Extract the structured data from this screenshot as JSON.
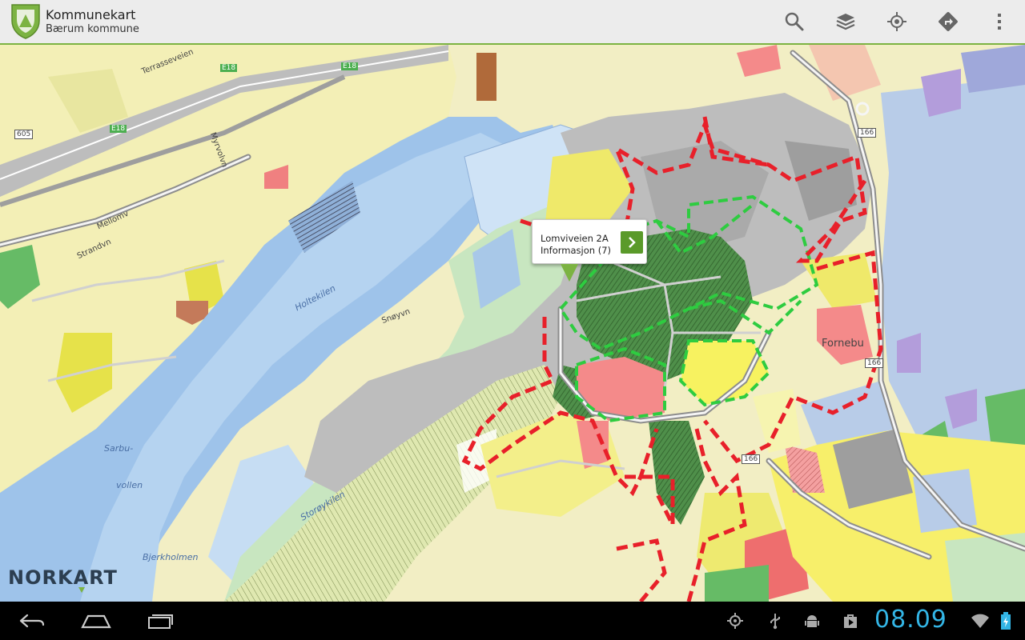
{
  "app": {
    "title": "Kommunekart",
    "subtitle": "Bærum kommune",
    "accent": "#7cb342"
  },
  "actionbar": {
    "actions": [
      {
        "icon": "search-icon",
        "label": "Search"
      },
      {
        "icon": "layers-icon",
        "label": "Layers"
      },
      {
        "icon": "my-location-icon",
        "label": "My location"
      },
      {
        "icon": "directions-icon",
        "label": "Directions"
      },
      {
        "icon": "overflow-menu-icon",
        "label": "More"
      }
    ]
  },
  "map": {
    "labels": {
      "holtekilen": "Holtekilen",
      "storoykilen": "Storøykilen",
      "sarbu": "Sarbu-",
      "vollen": "vollen",
      "bjerkholmen": "Bjerkholmen",
      "fornebu": "Fornebu",
      "terrasseveien": "Terrasseveien",
      "myrvolvn": "Myrvolvn",
      "mellomv": "Mellomv",
      "strandvn": "Strandvn",
      "snoyvn": "Snøyvn",
      "r166a": "166",
      "r166b": "166",
      "r166c": "166",
      "e18a": "E18",
      "e18b": "E18",
      "e18c": "E18",
      "r605": "605"
    },
    "callout": {
      "line1": "Lomviveien 2A",
      "line2": "Informasjon (7)"
    },
    "provider_logo": "NORKART"
  },
  "statusbar": {
    "time": "08.09",
    "time_color": "#33b5e5"
  },
  "navbar": {
    "buttons": [
      "back-icon",
      "home-icon",
      "recent-apps-icon"
    ]
  }
}
